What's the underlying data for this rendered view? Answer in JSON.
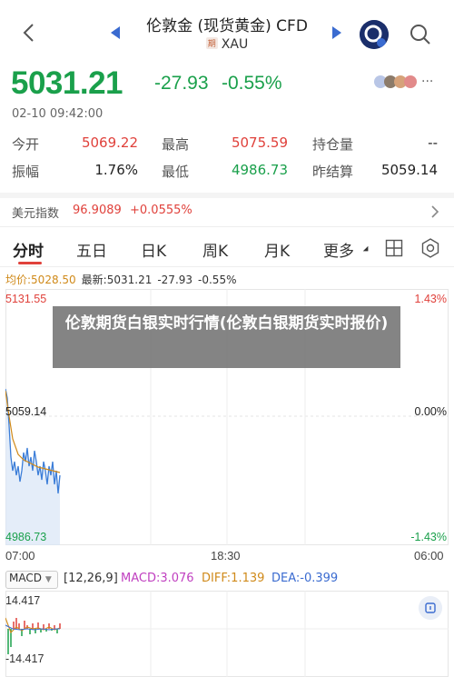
{
  "header": {
    "title": "伦敦金 (现货黄金) CFD",
    "subtitle_tag": "期",
    "subtitle": "XAU"
  },
  "quote": {
    "price": "5031.21",
    "change": "-27.93",
    "change_pct": "-0.55%",
    "timestamp": "02-10 09:42:00",
    "more": "···",
    "stats": {
      "open_label": "今开",
      "open_value": "5069.22",
      "high_label": "最高",
      "high_value": "5075.59",
      "oi_label": "持仓量",
      "oi_value": "--",
      "amp_label": "振幅",
      "amp_value": "1.76%",
      "low_label": "最低",
      "low_value": "4986.73",
      "prev_label": "昨结算",
      "prev_value": "5059.14"
    }
  },
  "index_bar": {
    "name": "美元指数",
    "value": "96.9089",
    "change": "+0.0555%"
  },
  "tabs": [
    {
      "label": "分时"
    },
    {
      "label": "五日"
    },
    {
      "label": "日K"
    },
    {
      "label": "周K"
    },
    {
      "label": "月K"
    },
    {
      "label": "更多"
    }
  ],
  "chart": {
    "avg_label": "均价:5028.50",
    "latest_label": "最新:5031.21",
    "latest_change": "-27.93",
    "latest_pct": "-0.55%",
    "y_top": "5131.55",
    "y_mid": "5059.14",
    "y_bottom": "4986.73",
    "pct_top": "1.43%",
    "pct_mid": "0.00%",
    "pct_bottom": "-1.43%",
    "time_start": "07:00",
    "time_mid": "18:30",
    "time_end": "06:00"
  },
  "overlay": {
    "text": "伦敦期货白银实时行情(伦敦白银期货实时报价)"
  },
  "macd": {
    "select": "MACD",
    "params": "[12,26,9]",
    "macd": "MACD:3.076",
    "diff": "DIFF:1.139",
    "dea": "DEA:-0.399",
    "y_top": "14.417",
    "y_bottom": "-14.417"
  },
  "colors": {
    "up": "#e0413b",
    "down": "#1aa04b",
    "price_line": "#3b7dd8",
    "avg_line": "#d08a1a"
  }
}
